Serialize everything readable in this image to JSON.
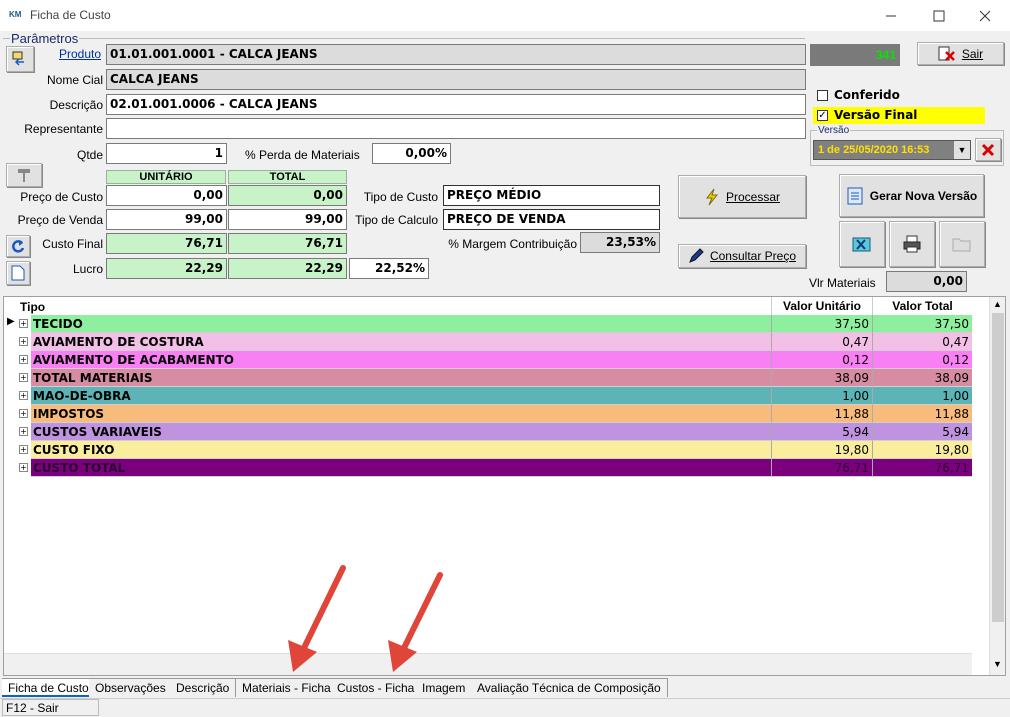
{
  "window": {
    "title": "Ficha de Custo",
    "app_icon_text": "KM"
  },
  "params": {
    "section_title": "Parâmetros",
    "produto_label": "Produto",
    "produto_value": "01.01.001.0001 - CALCA JEANS",
    "nome_cial_label": "Nome Cial",
    "nome_cial_value": "CALCA JEANS",
    "descricao_label": "Descrição",
    "descricao_value": "02.01.001.0006 - CALCA JEANS",
    "representante_label": "Representante",
    "representante_value": "",
    "qtde_label": "Qtde",
    "qtde_value": "1",
    "perda_label": "% Perda de Materiais",
    "perda_value": "0,00%",
    "counter_value": "341"
  },
  "costs": {
    "unitario_header": "UNITÁRIO",
    "total_header": "TOTAL",
    "preco_custo_label": "Preço de Custo",
    "preco_custo_unit": "0,00",
    "preco_custo_total": "0,00",
    "preco_venda_label": "Preço de Venda",
    "preco_venda_unit": "99,00",
    "preco_venda_total": "99,00",
    "custo_final_label": "Custo Final",
    "custo_final_unit": "76,71",
    "custo_final_total": "76,71",
    "lucro_label": "Lucro",
    "lucro_unit": "22,29",
    "lucro_total": "22,29",
    "lucro_pct": "22,52%",
    "tipo_custo_label": "Tipo de Custo",
    "tipo_custo_value": "PREÇO MÉDIO",
    "tipo_calculo_label": "Tipo de Calculo",
    "tipo_calculo_value": "PREÇO DE VENDA",
    "margem_label": "% Margem Contribuição",
    "margem_value": "23,53%"
  },
  "actions": {
    "sair": "Sair",
    "conferido_label": "Conferido",
    "conferido_checked": false,
    "versao_final_label": "Versão Final",
    "versao_final_checked": true,
    "versao_group": "Versão",
    "versao_value": "1 de 25/05/2020 16:53",
    "processar": "Processar",
    "gerar_nova_versao": "Gerar Nova Versão",
    "consultar_preco": "Consultar Preço",
    "vlr_materiais_label": "Vlr Materiais",
    "vlr_materiais_value": "0,00"
  },
  "grid": {
    "col_tipo": "Tipo",
    "col_unit": "Valor Unitário",
    "col_total": "Valor Total",
    "rows": [
      {
        "tipo": "TECIDO",
        "unit": "37,50",
        "total": "37,50",
        "color": "#8ef09e",
        "text": "#000000"
      },
      {
        "tipo": "AVIAMENTO DE COSTURA",
        "unit": "0,47",
        "total": "0,47",
        "color": "#f2bfe6",
        "text": "#000000"
      },
      {
        "tipo": "AVIAMENTO DE ACABAMENTO",
        "unit": "0,12",
        "total": "0,12",
        "color": "#f97ff4",
        "text": "#000000"
      },
      {
        "tipo": "TOTAL MATERIAIS",
        "unit": "38,09",
        "total": "38,09",
        "color": "#d88ca4",
        "text": "#000000"
      },
      {
        "tipo": "MAO-DE-OBRA",
        "unit": "1,00",
        "total": "1,00",
        "color": "#5cb4b6",
        "text": "#000000"
      },
      {
        "tipo": "IMPOSTOS",
        "unit": "11,88",
        "total": "11,88",
        "color": "#f7bb7c",
        "text": "#000000"
      },
      {
        "tipo": "CUSTOS VARIAVEIS",
        "unit": "5,94",
        "total": "5,94",
        "color": "#bf93e0",
        "text": "#000000"
      },
      {
        "tipo": "CUSTO FIXO",
        "unit": "19,80",
        "total": "19,80",
        "color": "#faee9e",
        "text": "#000000"
      },
      {
        "tipo": "CUSTO TOTAL",
        "unit": "76,71",
        "total": "76,71",
        "color": "#7a007e",
        "text": "#2b0030"
      }
    ]
  },
  "tabs": [
    "Ficha de Custo",
    "Observações",
    "Descrição",
    "Materiais - Ficha",
    "Custos - Ficha",
    "Imagem",
    "Avaliação Técnica de Composição"
  ],
  "status": {
    "hint": "F12 - Sair"
  }
}
